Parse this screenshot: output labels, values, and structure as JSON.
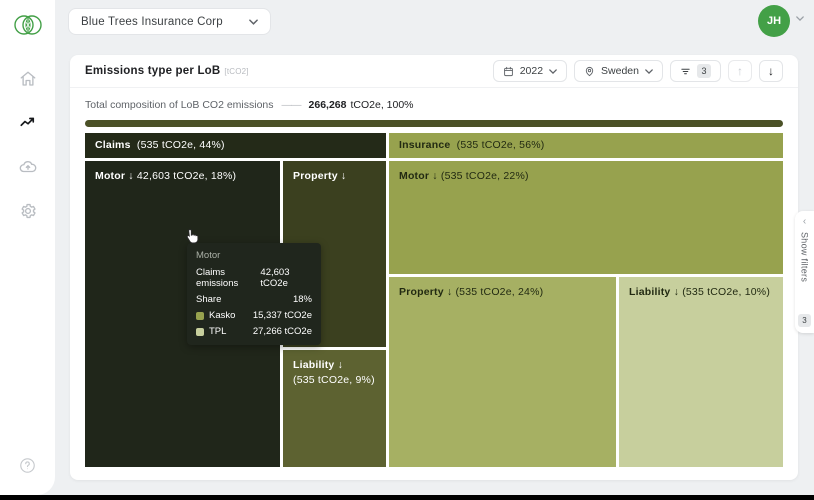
{
  "colors": {
    "brand_green": "#43A047",
    "total_bar": "#4b5127",
    "claims_header_bg": "#242a18",
    "claims_motor_bg": "#20261a",
    "claims_property_bg": "#3b401f",
    "claims_liability_bg": "#5d6231",
    "insurance_header_bg": "#97a24e",
    "insurance_motor_bg": "#97a24e",
    "insurance_property_bg": "#a6b063",
    "insurance_liability_bg": "#c7cf9d",
    "tooltip_bg": "#20261d",
    "kasko_swatch": "#97a24e",
    "tpl_swatch": "#c7cf9d"
  },
  "topbar": {
    "company_selector_label": "Blue Trees Insurance Corp",
    "avatar_initials": "JH"
  },
  "panel": {
    "title": "Emissions type per LoB",
    "title_unit": "[tCO2]",
    "filters": {
      "year_label": "2022",
      "region_label": "Sweden",
      "filter_count": "3",
      "up_arrow": "↑",
      "down_arrow": "↓"
    },
    "total": {
      "label": "Total composition of LoB CO2 emissions",
      "dash": "——",
      "value": "266,268",
      "suffix": "tCO2e, 100%"
    }
  },
  "treemap": {
    "claims": {
      "name": "Claims",
      "info": "(535 tCO2e, 44%)",
      "motor": {
        "name": "Motor",
        "arrow": "↓",
        "info": "42,603 tCO2e, 18%)"
      },
      "property": {
        "name": "Property",
        "arrow": "↓",
        "info": ""
      },
      "liability": {
        "name": "Liability",
        "arrow": "↓",
        "info": "(535 tCO2e, 9%)"
      }
    },
    "insurance": {
      "name": "Insurance",
      "info": "(535 tCO2e, 56%)",
      "motor": {
        "name": "Motor",
        "arrow": "↓",
        "info": "(535 tCO2e, 22%)"
      },
      "property": {
        "name": "Property",
        "arrow": "↓",
        "info": "(535 tCO2e, 24%)"
      },
      "liability": {
        "name": "Liability",
        "arrow": "↓",
        "info": "(535 tCO2e, 10%)"
      }
    }
  },
  "chart_data": {
    "type": "treemap",
    "title": "Emissions type per LoB [tCO2]",
    "total_tco2e": 266268,
    "total_share_pct": 100,
    "groups": [
      {
        "name": "Claims",
        "value_tco2e": 535,
        "share_pct": 44,
        "children": [
          {
            "name": "Motor",
            "value_tco2e": 42603,
            "share_pct": 18,
            "breakdown": [
              {
                "name": "Kasko",
                "value_tco2e": 15337
              },
              {
                "name": "TPL",
                "value_tco2e": 27266
              }
            ]
          },
          {
            "name": "Property"
          },
          {
            "name": "Liability",
            "value_tco2e": 535,
            "share_pct": 9
          }
        ]
      },
      {
        "name": "Insurance",
        "value_tco2e": 535,
        "share_pct": 56,
        "children": [
          {
            "name": "Motor",
            "value_tco2e": 535,
            "share_pct": 22
          },
          {
            "name": "Property",
            "value_tco2e": 535,
            "share_pct": 24
          },
          {
            "name": "Liability",
            "value_tco2e": 535,
            "share_pct": 10
          }
        ]
      }
    ]
  },
  "tooltip": {
    "title": "Motor",
    "rows": [
      {
        "label": "Claims emissions",
        "value": "42,603 tCO2e"
      },
      {
        "label": "Share",
        "value": "18%"
      },
      {
        "label": "Kasko",
        "value": "15,337 tCO2e"
      },
      {
        "label": "TPL",
        "value": "27,266 tCO2e"
      }
    ]
  },
  "show_filters_tab": {
    "chevron": "‹",
    "label": "Show filters",
    "badge": "3"
  }
}
